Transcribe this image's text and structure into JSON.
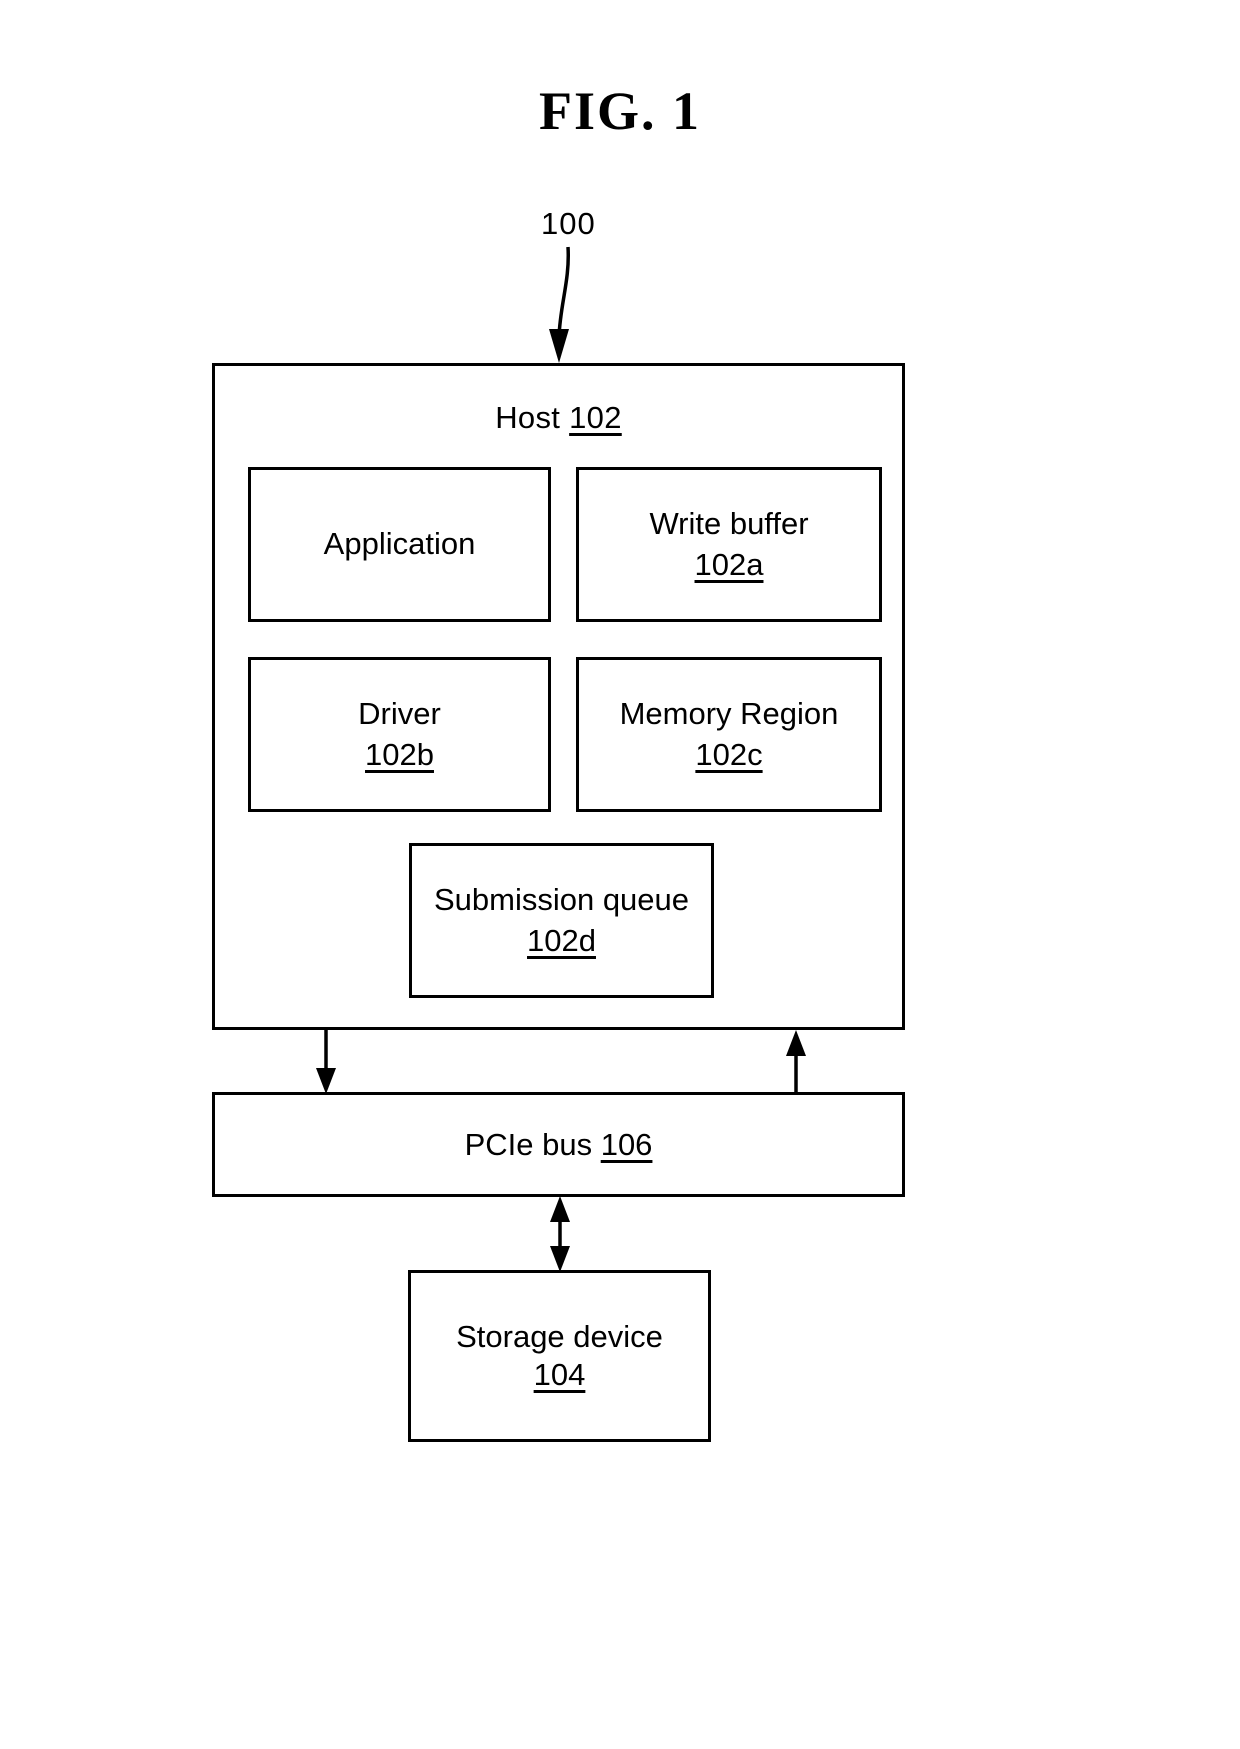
{
  "figure": {
    "title": "FIG. 1",
    "system_reference": "100"
  },
  "host": {
    "label": "Host",
    "reference": "102",
    "components": [
      {
        "name": "Application",
        "reference": ""
      },
      {
        "name": "Write buffer",
        "reference": "102a"
      },
      {
        "name": "Driver",
        "reference": "102b"
      },
      {
        "name": "Memory Region",
        "reference": "102c"
      },
      {
        "name": "Submission queue",
        "reference": "102d"
      }
    ]
  },
  "bus": {
    "label": "PCIe bus",
    "reference": "106"
  },
  "storage": {
    "label": "Storage device",
    "reference": "104"
  },
  "connectors": [
    {
      "name": "host-to-pcie",
      "direction": "down"
    },
    {
      "name": "pcie-to-host",
      "direction": "up"
    },
    {
      "name": "pcie-storage",
      "direction": "both"
    },
    {
      "name": "system-leader",
      "direction": "down"
    }
  ],
  "colors": {
    "stroke": "#000000",
    "background": "#ffffff"
  }
}
